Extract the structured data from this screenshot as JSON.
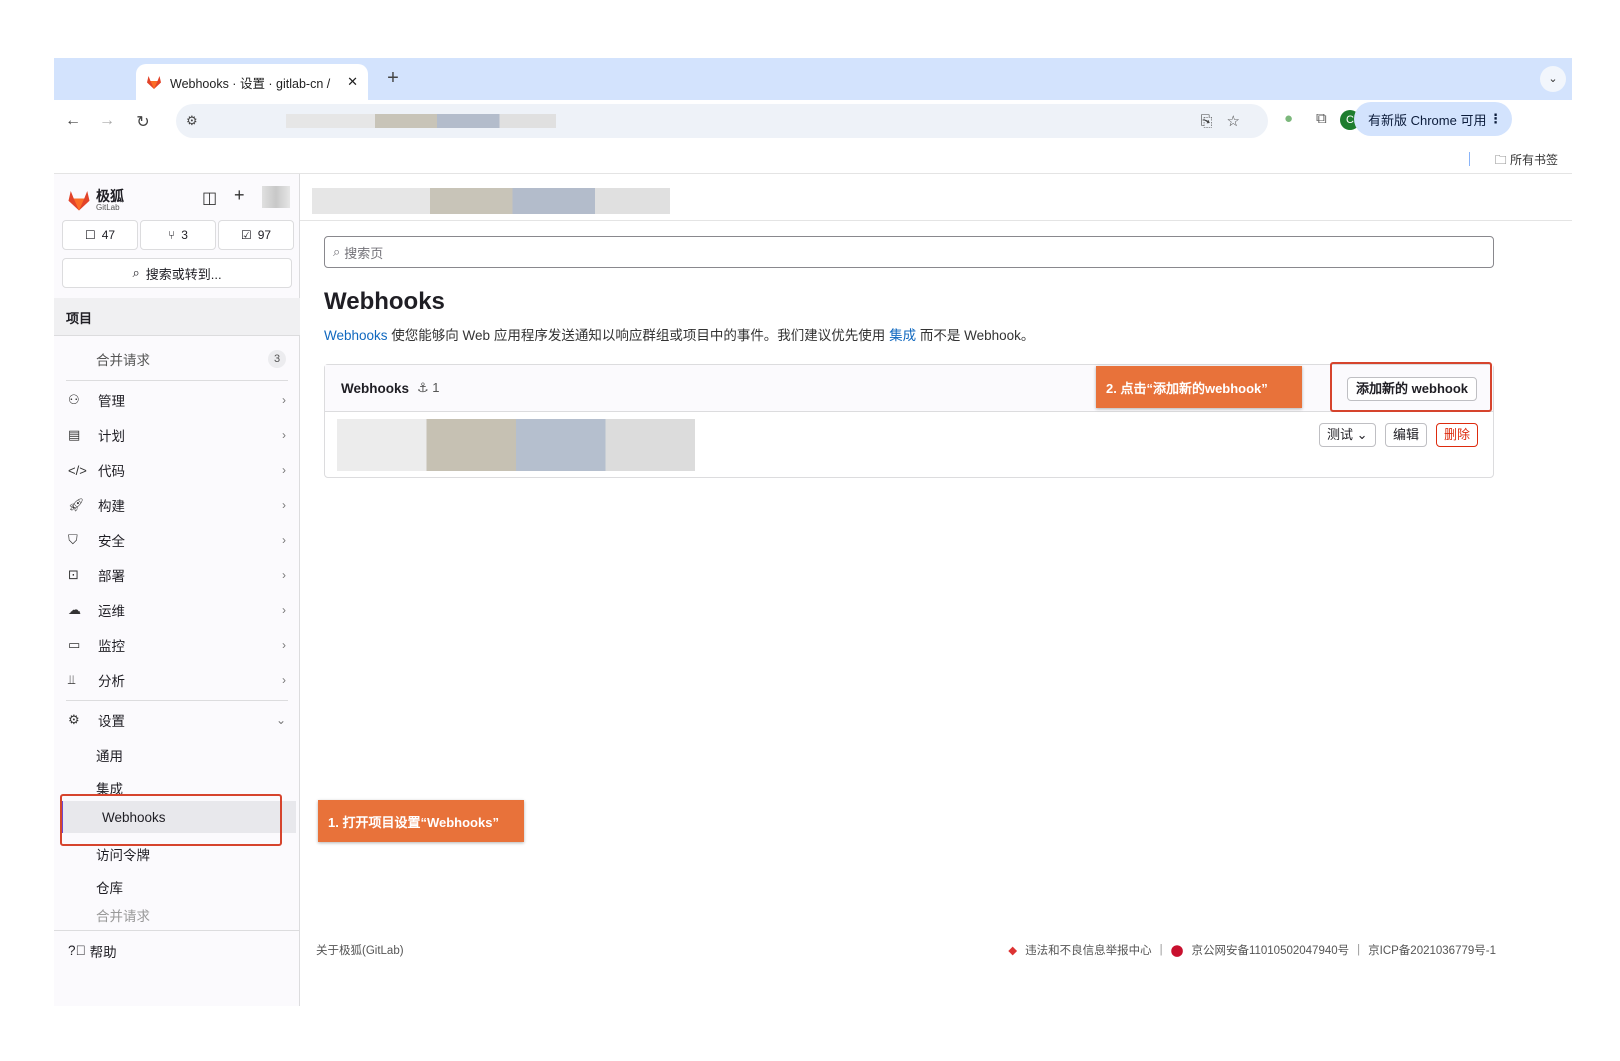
{
  "browser": {
    "tab_title": "Webhooks · 设置 · gitlab-cn /",
    "tab_close": "✕",
    "new_tab": "+",
    "tab_menu": "⌄",
    "update_button": "有新版 Chrome 可用",
    "profile_initial": "C",
    "bookmarks_all": "所有书签"
  },
  "sidebar": {
    "logo_title": "极狐",
    "logo_sub": "GitLab",
    "counters": [
      {
        "icon": "issues-icon",
        "value": "47"
      },
      {
        "icon": "merge-request-icon",
        "value": "3"
      },
      {
        "icon": "todo-icon",
        "value": "97"
      }
    ],
    "search_label": "搜索或转到...",
    "section_title": "项目",
    "pinned": {
      "label": "合并请求",
      "badge": "3"
    },
    "nav": [
      {
        "label": "管理",
        "icon": "users-icon"
      },
      {
        "label": "计划",
        "icon": "calendar-icon"
      },
      {
        "label": "代码",
        "icon": "code-icon"
      },
      {
        "label": "构建",
        "icon": "rocket-icon"
      },
      {
        "label": "安全",
        "icon": "shield-icon"
      },
      {
        "label": "部署",
        "icon": "deploy-icon"
      },
      {
        "label": "运维",
        "icon": "cloud-icon"
      },
      {
        "label": "监控",
        "icon": "monitor-icon"
      },
      {
        "label": "分析",
        "icon": "chart-icon"
      }
    ],
    "settings_label": "设置",
    "settings_items": [
      "通用",
      "集成",
      "Webhooks",
      "访问令牌",
      "仓库",
      "合并请求"
    ],
    "help_label": "帮助"
  },
  "main": {
    "search_placeholder": "搜索页",
    "title": "Webhooks",
    "desc_link1": "Webhooks",
    "desc_text1": " 使您能够向 Web 应用程序发送通知以响应群组或项目中的事件。我们建议优先使用 ",
    "desc_link2": "集成",
    "desc_text2": " 而不是 Webhook。",
    "card_title": "Webhooks",
    "card_count": "1",
    "add_button": "添加新的 webhook",
    "test_button": "测试",
    "edit_button": "编辑",
    "delete_button": "删除"
  },
  "footer": {
    "about": "关于极狐(GitLab)",
    "report": "违法和不良信息举报中心",
    "police": "京公网安备11010502047940号",
    "icp": "京ICP备2021036779号-1"
  },
  "annotations": {
    "step1": "1. 打开项目设置“Webhooks”",
    "step2": "2. 点击“添加新的webhook”"
  },
  "colors": {
    "accent": "#1068bf",
    "annotation": "#e8723a",
    "danger": "#dd2b0e",
    "chrome_tabstrip": "#d3e3fd"
  }
}
